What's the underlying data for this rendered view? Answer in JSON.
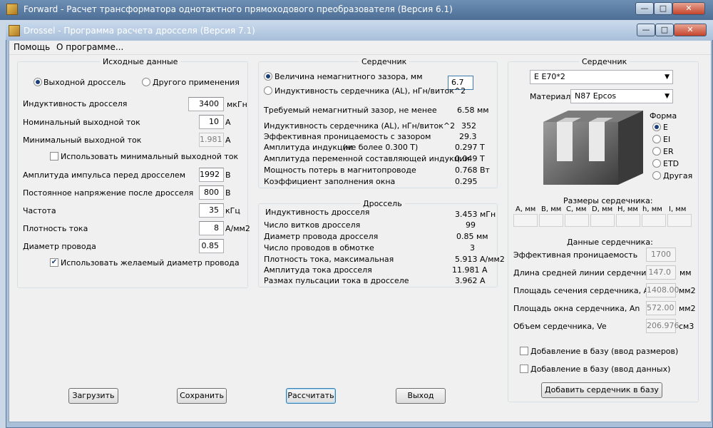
{
  "outer_window": {
    "title": "Forward - Расчет трансформатора однотактного прямоходового преобразователя (Версия 6.1)"
  },
  "inner_window": {
    "title": "Drossel - Программа расчета дросселя (Версия 7.1)"
  },
  "caption_buttons": {
    "minimize": "—",
    "maximize": "□",
    "close": "✕"
  },
  "menu": {
    "help": "Помощь",
    "about": "О программе..."
  },
  "input": {
    "title": "Исходные данные",
    "radio_output": "Выходной дроссель",
    "radio_other": "Другого применения",
    "inductance": {
      "label": "Индуктивность  дросселя",
      "value": "3400",
      "unit": "мкГн"
    },
    "nom_current": {
      "label": "Номинальный выходной ток",
      "value": "10",
      "unit": "А"
    },
    "min_current": {
      "label": "Минимальный выходной ток",
      "value": "1.981",
      "unit": "А"
    },
    "use_min_current": "Использовать минимальный выходной ток",
    "pulse_amp": {
      "label": "Амплитуда импульса перед дросселем",
      "value": "1992",
      "unit": "В"
    },
    "dc_voltage": {
      "label": "Постоянное напряжение после дросселя",
      "value": "800",
      "unit": "В"
    },
    "frequency": {
      "label": "Частота",
      "value": "35",
      "unit": "кГц"
    },
    "current_density": {
      "label": "Плотность тока",
      "value": "8",
      "unit": "А/мм2"
    },
    "wire_diameter": {
      "label": "Диаметр провода",
      "value": "0.85"
    },
    "use_wire_diameter": "Использовать желаемый диаметр провода"
  },
  "core_calc": {
    "title": "Сердечник",
    "radio_gap": "Величина немагнитного зазора, мм",
    "radio_al": "Индуктивность сердечника (AL), нГн/виток^2",
    "gap_value": "6.7",
    "rows": [
      {
        "label": "Требуемый немагнитный зазор, не менее",
        "value": "6.58 мм"
      },
      {
        "label": "Индуктивность сердечника (AL), нГн/виток^2",
        "value": "352"
      },
      {
        "label": "Эффективная проницаемость с зазором",
        "value": "29.3"
      },
      {
        "label": "Амплитуда индукции",
        "note": "(не более 0.300 Т)",
        "value": "0.297 Т"
      },
      {
        "label": "Амплитуда переменной составляющей индукции",
        "value": "0.049 Т"
      },
      {
        "label": "Мощность потерь в магнитопроводе",
        "value": "0.768 Вт"
      },
      {
        "label": "Коэффициент заполнения окна",
        "value": "0.295"
      }
    ]
  },
  "choke": {
    "title": "Дроссель",
    "rows": [
      {
        "label": "Индуктивность дросселя",
        "value": "3.453 мГн"
      },
      {
        "label": "Число витков дросселя",
        "value": "99"
      },
      {
        "label": "Диаметр провода дросселя",
        "value": "0.85 мм"
      },
      {
        "label": "Число проводов в обмотке",
        "value": "3"
      },
      {
        "label": "Плотность тока, максимальная",
        "value": "5.913 А/мм2"
      },
      {
        "label": "Амплитуда тока дросселя",
        "value": "11.981 А"
      },
      {
        "label": "Размах пульсации тока в дросселе",
        "value": "3.962 А"
      }
    ]
  },
  "core_select": {
    "title": "Сердечник",
    "core": "E E70*2",
    "material_label": "Материал:",
    "material": "N87 Epcos",
    "shape_title": "Форма",
    "shapes": [
      "E",
      "EI",
      "ER",
      "ETD",
      "Другая"
    ],
    "dims_title": "Размеры сердечника:",
    "dims": [
      "A, мм",
      "B, мм",
      "C, мм",
      "D, мм",
      "H, мм",
      "h, мм",
      "I, мм"
    ],
    "data_title": "Данные сердечника:",
    "data": [
      {
        "label": "Эффективная проницаемость",
        "value": "1700",
        "unit": ""
      },
      {
        "label": "Длина средней линии сердечника, le",
        "value": "147.0",
        "unit": "мм"
      },
      {
        "label": "Площадь сечения сердечника, Ae",
        "value": "1408.00",
        "unit": "мм2"
      },
      {
        "label": "Площадь окна сердечника, An",
        "value": "572.00",
        "unit": "мм2"
      },
      {
        "label": "Объем сердечника, Ve",
        "value": "206.976",
        "unit": "см3"
      }
    ],
    "add_dims": "Добавление в базу (ввод размеров)",
    "add_data": "Добавление в базу (ввод данных)",
    "add_core_button": "Добавить сердечник в базу"
  },
  "buttons": {
    "load": "Загрузить",
    "save": "Сохранить",
    "calc": "Рассчитать",
    "exit": "Выход"
  }
}
